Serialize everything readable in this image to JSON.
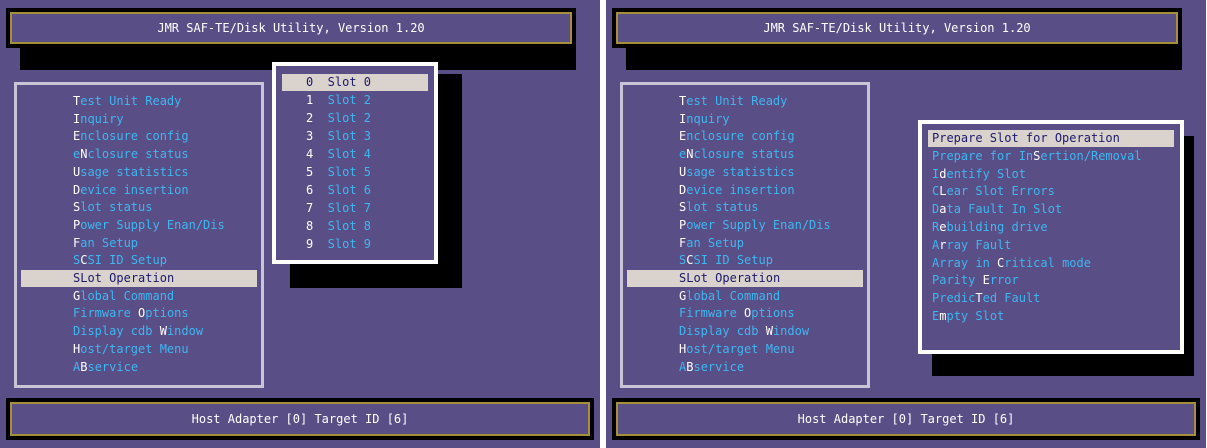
{
  "title": "JMR SAF-TE/Disk Utility, Version 1.20",
  "status": "Host Adapter [0]   Target ID [6]",
  "menu": [
    {
      "hot": "T",
      "rest": "est Unit Ready"
    },
    {
      "hot": "I",
      "rest": "nquiry"
    },
    {
      "hot": "E",
      "rest": "nclosure config"
    },
    {
      "pre": "e",
      "hot": "N",
      "rest": "closure status"
    },
    {
      "hot": "U",
      "rest": "sage statistics"
    },
    {
      "hot": "D",
      "rest": "evice insertion"
    },
    {
      "hot": "S",
      "rest": "lot status"
    },
    {
      "hot": "P",
      "rest": "ower Supply Enan/Dis"
    },
    {
      "hot": "F",
      "rest": "an Setup"
    },
    {
      "pre": "S",
      "hot": "C",
      "rest": "SI ID Setup"
    },
    {
      "pre": "S",
      "hot": "L",
      "rest": "ot Operation"
    },
    {
      "hot": "G",
      "rest": "lobal Command"
    },
    {
      "pre": "Firmware ",
      "hot": "O",
      "rest": "ptions"
    },
    {
      "pre": "Display cdb ",
      "hot": "W",
      "rest": "indow"
    },
    {
      "hot": "H",
      "rest": "ost/target Menu"
    },
    {
      "pre": "A",
      "hot": "B",
      "rest": "service"
    }
  ],
  "menu_selected_index": 10,
  "slot_popup": [
    {
      "hot": "0",
      "rest": "  Slot 0"
    },
    {
      "hot": "1",
      "rest": "  Slot 2"
    },
    {
      "hot": "2",
      "rest": "  Slot 2"
    },
    {
      "hot": "3",
      "rest": "  Slot 3"
    },
    {
      "hot": "4",
      "rest": "  Slot 4"
    },
    {
      "hot": "5",
      "rest": "  Slot 5"
    },
    {
      "hot": "6",
      "rest": "  Slot 6"
    },
    {
      "hot": "7",
      "rest": "  Slot 7"
    },
    {
      "hot": "8",
      "rest": "  Slot 8"
    },
    {
      "hot": "9",
      "rest": "  Slot 9"
    }
  ],
  "slot_selected_index": 0,
  "op_popup": [
    {
      "hot": "P",
      "rest": "repare Slot for Operation"
    },
    {
      "pre": "Prepare for In",
      "hot": "S",
      "rest": "ertion/Removal"
    },
    {
      "pre": "I",
      "hot": "d",
      "rest": "entify Slot"
    },
    {
      "pre": "C",
      "hot": "L",
      "rest": "ear Slot Errors"
    },
    {
      "pre": "D",
      "hot": "a",
      "rest": "ta Fault In Slot"
    },
    {
      "pre": "R",
      "hot": "e",
      "rest": "building drive"
    },
    {
      "pre": "A",
      "hot": "r",
      "rest": "ray Fault"
    },
    {
      "pre": "Array in ",
      "hot": "C",
      "rest": "ritical mode"
    },
    {
      "pre": "Parity ",
      "hot": "E",
      "rest": "rror"
    },
    {
      "pre": "Predic",
      "hot": "T",
      "rest": "ed Fault"
    },
    {
      "pre": "E",
      "hot": "m",
      "rest": "pty Slot"
    }
  ],
  "op_selected_index": 0,
  "colors": {
    "background": "#5a4e87",
    "menu_text": "#3fb6f0",
    "hotkey_text": "#ffffff",
    "selection_bg": "#d9d2cd",
    "selection_text": "#1d1a6a",
    "frame_gold": "#a58f3a"
  }
}
